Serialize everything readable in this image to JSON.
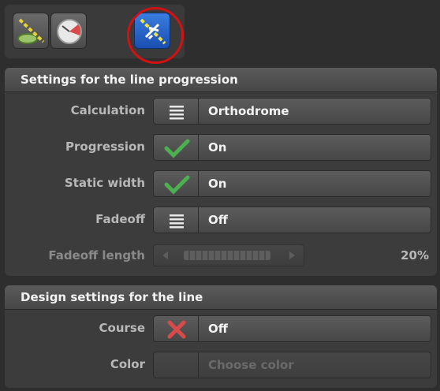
{
  "tabs": [
    {
      "icon": "line-path-globe-icon",
      "active": false
    },
    {
      "icon": "gauge-icon",
      "active": false
    },
    {
      "icon": "airplane-line-icon",
      "active": true
    }
  ],
  "line_progression": {
    "title": "Settings for the line progression",
    "rows": [
      {
        "label": "Calculation",
        "icon": "list-menu-icon",
        "value": "Orthodrome"
      },
      {
        "label": "Progression",
        "icon": "checkmark-icon",
        "value": "On"
      },
      {
        "label": "Static width",
        "icon": "checkmark-icon",
        "value": "On"
      },
      {
        "label": "Fadeoff",
        "icon": "list-menu-icon",
        "value": "Off"
      }
    ],
    "fadeoff_length": {
      "label": "Fadeoff length",
      "value": "20%"
    }
  },
  "design": {
    "title": "Design settings for the line",
    "course": {
      "label": "Course",
      "icon": "x-mark-icon",
      "value": "Off"
    },
    "color": {
      "label": "Color",
      "value": "Choose color"
    }
  },
  "colors": {
    "accent_blue": "#1a4fb0",
    "highlight_red": "#d11212",
    "check_green": "#4caf50",
    "x_red": "#d94a4a"
  }
}
